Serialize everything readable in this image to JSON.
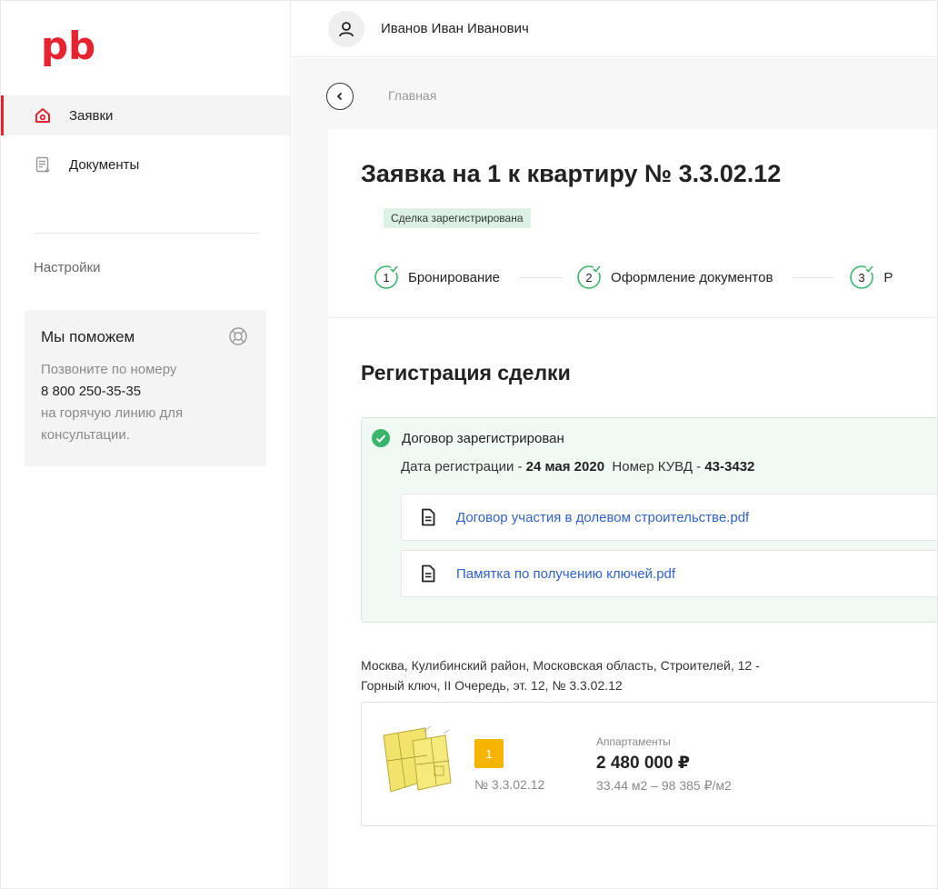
{
  "app": {
    "logo_text": "pb",
    "brand_color": "#e8232f",
    "accent_green": "#3bb56c",
    "link_color": "#2f63c9"
  },
  "sidebar": {
    "items": [
      {
        "label": "Заявки",
        "icon": "home-icon",
        "active": true
      },
      {
        "label": "Документы",
        "icon": "document-list-icon",
        "active": false
      }
    ],
    "settings_label": "Настройки",
    "help": {
      "title": "Мы поможем",
      "icon": "lifebuoy-icon",
      "line1": "Позвоните по номеру",
      "phone": "8 800 250-35-35",
      "line2": "на горячую линию для",
      "line3": "консультации."
    }
  },
  "header": {
    "user_icon": "user-icon",
    "user_name": "Иванов Иван Иванович"
  },
  "breadcrumb": {
    "back_icon": "chevron-left-icon",
    "label": "Главная"
  },
  "request": {
    "title": "Заявка на 1 к квартиру № 3.3.02.12",
    "status": "Сделка зарегистрирована",
    "steps": [
      {
        "number": "1",
        "label": "Бронирование",
        "done": true
      },
      {
        "number": "2",
        "label": "Оформление документов",
        "done": true
      },
      {
        "number": "3",
        "label": "Р",
        "done": true
      }
    ]
  },
  "registration": {
    "section_title": "Регистрация сделки",
    "status_text": "Договор зарегистрирован",
    "date_label": "Дата регистрации - ",
    "date_value": "24 мая 2020",
    "kuvd_label": "Номер КУВД - ",
    "kuvd_value": "43-3432",
    "documents": [
      {
        "name": "Договор участия в долевом строительстве.pdf",
        "icon": "file-icon"
      },
      {
        "name": "Памятка по получению ключей.pdf",
        "icon": "file-icon"
      }
    ]
  },
  "apartment": {
    "address_line1": "Москва, Кулибинский район, Московская область, Строителей, 12 -",
    "address_line2": "Горный ключ, II Очередь, эт. 12, № 3.3.02.12",
    "floor_badge": "1",
    "number": "№ 3.3.02.12",
    "type": "Аппартаменты",
    "price": "2 480 000 ₽",
    "area_price": "33.44 м2 – 98 385 ₽/м2"
  }
}
